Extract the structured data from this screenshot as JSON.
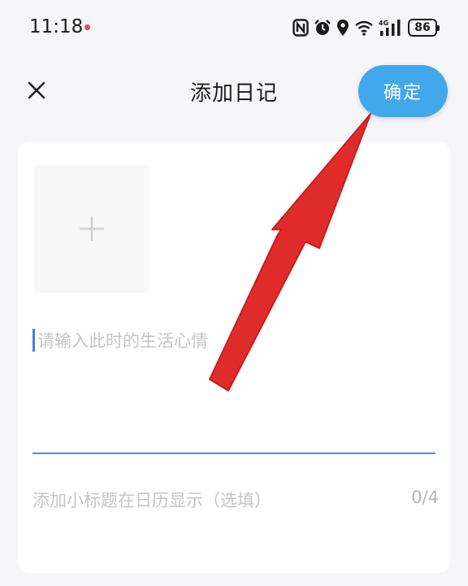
{
  "status_bar": {
    "time": "11:18",
    "battery": "86",
    "signal": "4G",
    "icons": [
      "nfc-icon",
      "alarm-icon",
      "location-icon",
      "wifi-icon",
      "cellular-signal-icon",
      "battery-icon"
    ]
  },
  "header": {
    "close_icon": "close-icon",
    "title": "添加日记",
    "confirm_label": "确定"
  },
  "editor": {
    "add_photo_icon": "plus-icon",
    "mood_placeholder": "请输入此时的生活心情",
    "subtitle_placeholder": "添加小标题在日历显示（选填）",
    "subtitle_counter": "0/4"
  },
  "annotation": {
    "arrow_color": "#e02b2b",
    "target": "confirm-button"
  },
  "colors": {
    "accent": "#42a8ec",
    "underline": "#4a8fdc",
    "placeholder": "#c4c4c4",
    "background": "#f6f6f8"
  }
}
